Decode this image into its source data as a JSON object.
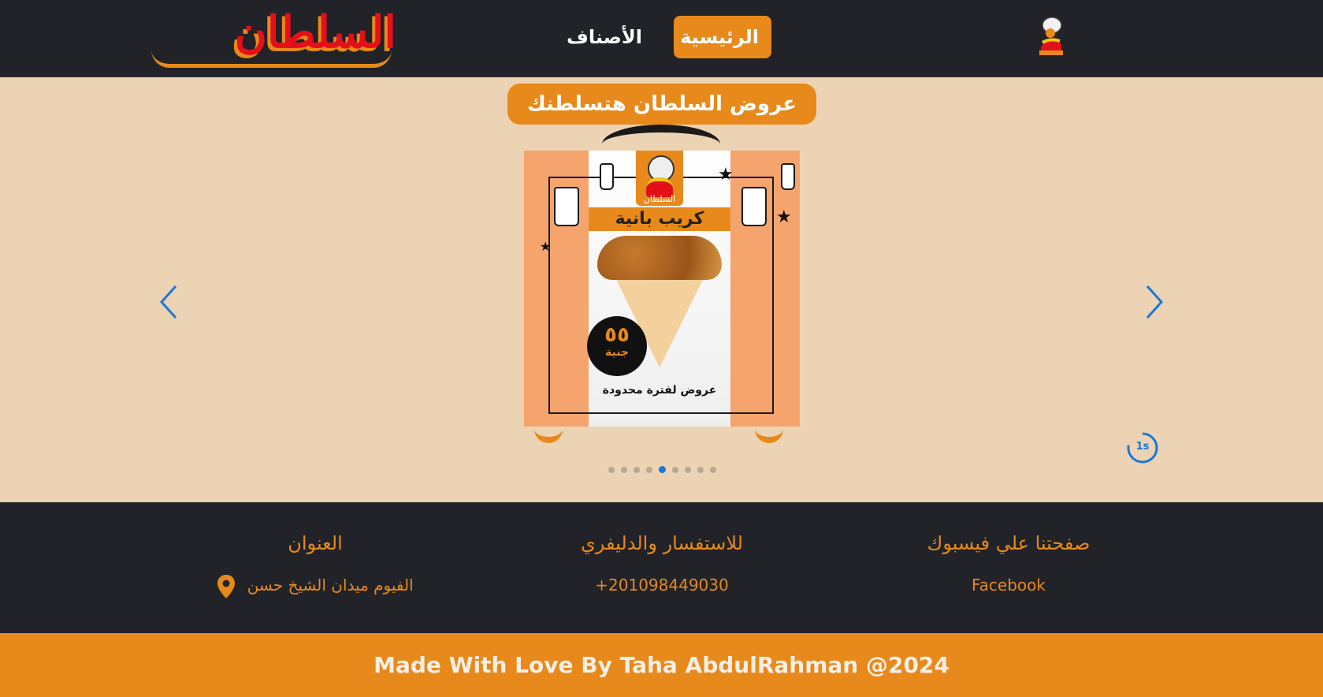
{
  "header": {
    "brand": "السلطان",
    "nav": {
      "home": "الرئيسية",
      "categories": "الأصناف"
    },
    "logo_icon": "sultan-mascot-icon"
  },
  "main": {
    "offer_title": "عروض السلطان هتسلطنك",
    "slide": {
      "logo_text": "السلطان",
      "title": "كريب بانية",
      "price_number": "٥٥",
      "price_unit": "جنية",
      "footer_text": "عروض لفترة محدودة"
    },
    "carousel": {
      "timer": "1s",
      "slide_count": 9,
      "active_index": 4,
      "prev_icon": "chevron-left-icon",
      "next_icon": "chevron-right-icon"
    }
  },
  "footer": {
    "facebook": {
      "title": "صفحتنا علي فيسبوك",
      "link": "Facebook"
    },
    "contact": {
      "title": "للاستفسار والدليفري",
      "phone": "+201098449030"
    },
    "address": {
      "title": "العنوان",
      "value": "الفيوم ميدان الشيخ حسن",
      "icon": "map-pin-icon"
    },
    "copyright": "Made With Love By Taha AbdulRahman @2024"
  },
  "colors": {
    "accent": "#e8891b",
    "dark": "#212328",
    "background": "#ecd3b3",
    "brand_red": "#e3101a",
    "carousel_blue": "#1a78d8"
  }
}
